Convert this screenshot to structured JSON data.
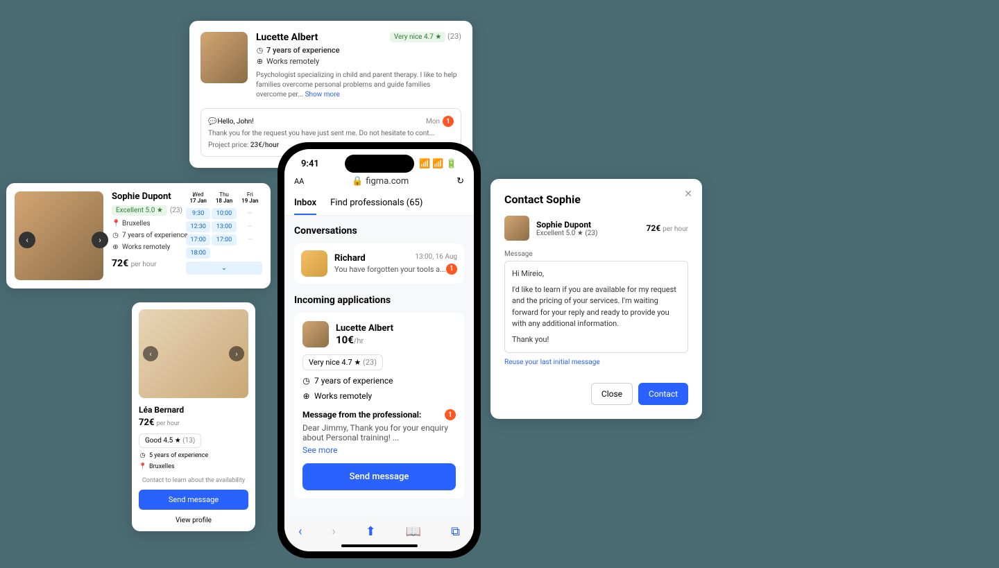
{
  "card1": {
    "name": "Lucette Albert",
    "experience": "7 years of experience",
    "remote": "Works remotely",
    "ratingLabel": "Very nice 4.7",
    "ratingCount": "(23)",
    "bio": "Psychologist specializing in child and parent therapy. I like to help families overcome personal problems and guide families overcome per... ",
    "showMore": "Show more",
    "msgGreeting": "Hello, John!",
    "msgBody": "Thank you for the request you have just sent me. Do not hesitate to cont...",
    "msgDay": "Mon",
    "msgBadge": "1",
    "priceLabel": "Project price:",
    "priceValue": "23€/hour"
  },
  "card2": {
    "name": "Sophie Dupont",
    "ratingLabel": "Excellent 5.0",
    "ratingCount": "(23)",
    "location": "Bruxelles",
    "experience": "7 years of experience",
    "remote": "Works remotely",
    "price": "72€",
    "priceUnit": "per hour",
    "days": [
      {
        "dow": "Wed",
        "date": "17 Jan"
      },
      {
        "dow": "Thu",
        "date": "18 Jan"
      },
      {
        "dow": "Fri",
        "date": "19 Jan"
      }
    ],
    "col1": [
      "9:30",
      "12:30",
      "17:00",
      "18:00"
    ],
    "col2": [
      "10:00",
      "13:00",
      "17:00"
    ],
    "col3": [
      "—",
      "—",
      "—"
    ]
  },
  "card3": {
    "name": "Léa Bernard",
    "price": "72€",
    "priceUnit": "per hour",
    "ratingLabel": "Good 4.5",
    "ratingCount": "(13)",
    "experience": "5 years of experience",
    "location": "Bruxelles",
    "availability": "Contact to learn about the availability",
    "sendBtn": "Send message",
    "viewLink": "View profile"
  },
  "phone": {
    "time": "9:41",
    "url": "figma.com",
    "tabInbox": "Inbox",
    "tabFind": "Find professionals (65)",
    "convHeader": "Conversations",
    "conv": {
      "name": "Richard",
      "msg": "You have forgotten your tools a...",
      "time": "13:00, 16 Aug",
      "badge": "1"
    },
    "appHeader": "Incoming applications",
    "app": {
      "name": "Lucette Albert",
      "price": "10€",
      "priceUnit": "/hr",
      "ratingLabel": "Very nice 4.7",
      "ratingCount": "(23)",
      "experience": "7 years of experience",
      "remote": "Works remotely",
      "msgHeader": "Message from the professional:",
      "msgBadge": "1",
      "msgText": "Dear Jimmy, Thank you for your enquiry about Personal training! ...",
      "seeMore": "See more",
      "sendBtn": "Send message"
    }
  },
  "modal": {
    "title": "Contact Sophie",
    "name": "Sophie Dupont",
    "rating": "Excellent 5.0 ★ (23)",
    "price": "72€",
    "priceUnit": "per hour",
    "msgLabel": "Message",
    "msgGreeting": "Hi Mireio,",
    "msgBody": "I'd like to learn if you are available for my request and the pricing of your services. I'm waiting forward for your reply and ready to provide you with any additional information.",
    "msgThanks": "Thank you!",
    "reuse": "Reuse your last initial message",
    "closeBtn": "Close",
    "contactBtn": "Contact"
  }
}
